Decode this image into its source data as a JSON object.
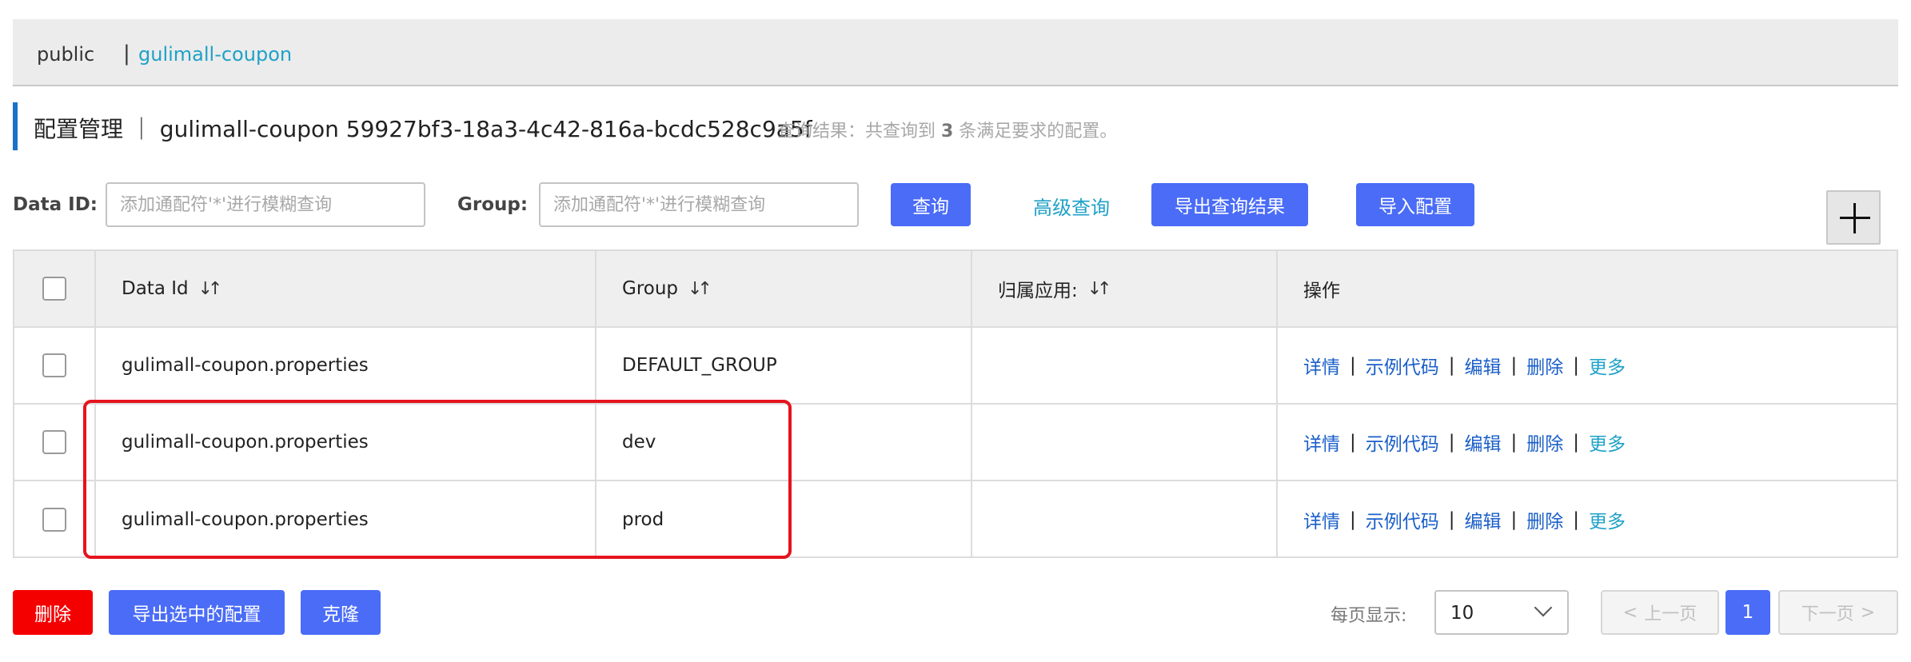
{
  "namespace": {
    "items": [
      "public",
      "gulimall-coupon"
    ],
    "separator": "|"
  },
  "header": {
    "title": "配置管理 ｜ gulimall-coupon  59927bf3-18a3-4c42-816a-bcdc528c9a5f",
    "result_prefix": "查询结果：共查询到 ",
    "result_count": "3",
    "result_suffix": " 条满足要求的配置。"
  },
  "filters": {
    "data_id_label": "Data ID:",
    "data_id_placeholder": "添加通配符'*'进行模糊查询",
    "group_label": "Group:",
    "group_placeholder": "添加通配符'*'进行模糊查询",
    "query_label": "查询",
    "advanced_label": "高级查询",
    "export_result_label": "导出查询结果",
    "import_label": "导入配置"
  },
  "table": {
    "columns": [
      "Data Id",
      "Group",
      "归属应用:",
      "操作"
    ],
    "sort_glyph": "↓↑",
    "rows": [
      {
        "data_id": "gulimall-coupon.properties",
        "group": "DEFAULT_GROUP",
        "app": ""
      },
      {
        "data_id": "gulimall-coupon.properties",
        "group": "dev",
        "app": ""
      },
      {
        "data_id": "gulimall-coupon.properties",
        "group": "prod",
        "app": ""
      }
    ],
    "actions": [
      "详情",
      "示例代码",
      "编辑",
      "删除",
      "更多"
    ],
    "action_separator": "|"
  },
  "footer": {
    "delete_label": "删除",
    "export_selected_label": "导出选中的配置",
    "clone_label": "克隆",
    "page_size_label": "每页显示:",
    "page_size_value": "10",
    "prev_label": "上一页",
    "next_label": "下一页",
    "current_page": "1",
    "prev_glyph": "<",
    "next_glyph": ">"
  },
  "colors": {
    "primary": "#4a6cf7",
    "danger": "#f50000",
    "link": "#1a5fc9",
    "accent": "#1fa1c8",
    "highlight": "#e5131d"
  }
}
